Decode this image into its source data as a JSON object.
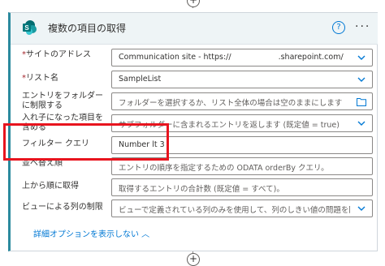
{
  "action": {
    "title": "複数の項目の取得",
    "help_icon": "?",
    "more_icon": "···",
    "icon": "sharepoint-icon"
  },
  "fields": [
    {
      "label_req": "*",
      "label": "サイトのアドレス",
      "value": "Communication site - https://",
      "value_tail": ".sharepoint.com/",
      "control": "chevron-down"
    },
    {
      "label_req": "*",
      "label": "リスト名",
      "value": "SampleList",
      "control": "chevron-down"
    },
    {
      "label": "エントリをフォルダーに制限する",
      "placeholder": "フォルダーを選択するか、リスト全体の場合は空のままにします",
      "control": "folder"
    },
    {
      "label": "入れ子になった項目を含める",
      "placeholder": "サブフォルダーに含まれるエントリを返します (既定値 = true)",
      "control": "chevron-down"
    },
    {
      "label": "フィルター クエリ",
      "value": "Number lt 3"
    },
    {
      "label": "並べ替え順",
      "placeholder": "エントリの順序を指定するための ODATA orderBy クエリ。"
    },
    {
      "label": "上から順に取得",
      "placeholder": "取得するエントリの合計数 (既定値 = すべて)。"
    },
    {
      "label": "ビューによる列の制限",
      "placeholder": "ビューで定義されている列のみを使用して、列のしきい値の問題を回避",
      "control": "chevron-down"
    }
  ],
  "advanced_link": "詳細オプションを表示しない ︿",
  "colors": {
    "accent": "#0078d4",
    "highlight": "#e8141e",
    "header_bg": "#eef4f6"
  }
}
